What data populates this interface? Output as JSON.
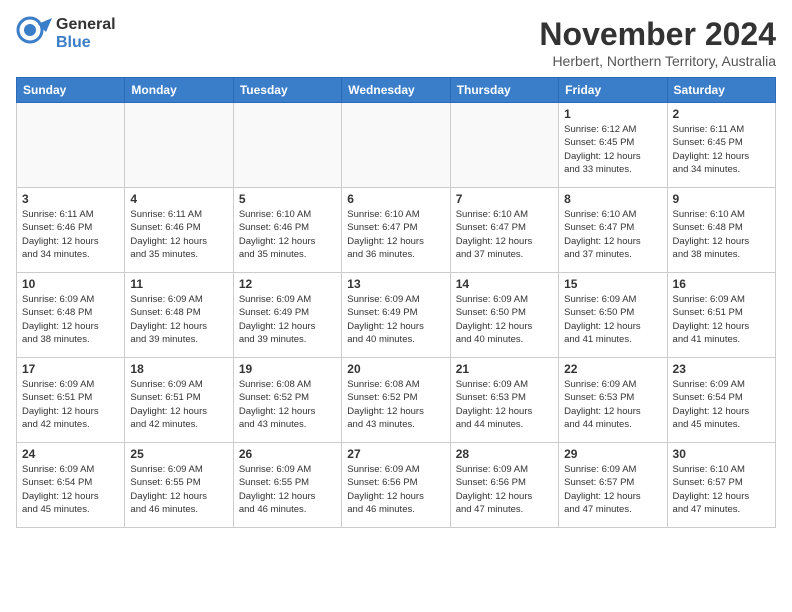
{
  "header": {
    "logo_general": "General",
    "logo_blue": "Blue",
    "month": "November 2024",
    "location": "Herbert, Northern Territory, Australia"
  },
  "weekdays": [
    "Sunday",
    "Monday",
    "Tuesday",
    "Wednesday",
    "Thursday",
    "Friday",
    "Saturday"
  ],
  "weeks": [
    [
      {
        "day": "",
        "info": ""
      },
      {
        "day": "",
        "info": ""
      },
      {
        "day": "",
        "info": ""
      },
      {
        "day": "",
        "info": ""
      },
      {
        "day": "",
        "info": ""
      },
      {
        "day": "1",
        "info": "Sunrise: 6:12 AM\nSunset: 6:45 PM\nDaylight: 12 hours\nand 33 minutes."
      },
      {
        "day": "2",
        "info": "Sunrise: 6:11 AM\nSunset: 6:45 PM\nDaylight: 12 hours\nand 34 minutes."
      }
    ],
    [
      {
        "day": "3",
        "info": "Sunrise: 6:11 AM\nSunset: 6:46 PM\nDaylight: 12 hours\nand 34 minutes."
      },
      {
        "day": "4",
        "info": "Sunrise: 6:11 AM\nSunset: 6:46 PM\nDaylight: 12 hours\nand 35 minutes."
      },
      {
        "day": "5",
        "info": "Sunrise: 6:10 AM\nSunset: 6:46 PM\nDaylight: 12 hours\nand 35 minutes."
      },
      {
        "day": "6",
        "info": "Sunrise: 6:10 AM\nSunset: 6:47 PM\nDaylight: 12 hours\nand 36 minutes."
      },
      {
        "day": "7",
        "info": "Sunrise: 6:10 AM\nSunset: 6:47 PM\nDaylight: 12 hours\nand 37 minutes."
      },
      {
        "day": "8",
        "info": "Sunrise: 6:10 AM\nSunset: 6:47 PM\nDaylight: 12 hours\nand 37 minutes."
      },
      {
        "day": "9",
        "info": "Sunrise: 6:10 AM\nSunset: 6:48 PM\nDaylight: 12 hours\nand 38 minutes."
      }
    ],
    [
      {
        "day": "10",
        "info": "Sunrise: 6:09 AM\nSunset: 6:48 PM\nDaylight: 12 hours\nand 38 minutes."
      },
      {
        "day": "11",
        "info": "Sunrise: 6:09 AM\nSunset: 6:48 PM\nDaylight: 12 hours\nand 39 minutes."
      },
      {
        "day": "12",
        "info": "Sunrise: 6:09 AM\nSunset: 6:49 PM\nDaylight: 12 hours\nand 39 minutes."
      },
      {
        "day": "13",
        "info": "Sunrise: 6:09 AM\nSunset: 6:49 PM\nDaylight: 12 hours\nand 40 minutes."
      },
      {
        "day": "14",
        "info": "Sunrise: 6:09 AM\nSunset: 6:50 PM\nDaylight: 12 hours\nand 40 minutes."
      },
      {
        "day": "15",
        "info": "Sunrise: 6:09 AM\nSunset: 6:50 PM\nDaylight: 12 hours\nand 41 minutes."
      },
      {
        "day": "16",
        "info": "Sunrise: 6:09 AM\nSunset: 6:51 PM\nDaylight: 12 hours\nand 41 minutes."
      }
    ],
    [
      {
        "day": "17",
        "info": "Sunrise: 6:09 AM\nSunset: 6:51 PM\nDaylight: 12 hours\nand 42 minutes."
      },
      {
        "day": "18",
        "info": "Sunrise: 6:09 AM\nSunset: 6:51 PM\nDaylight: 12 hours\nand 42 minutes."
      },
      {
        "day": "19",
        "info": "Sunrise: 6:08 AM\nSunset: 6:52 PM\nDaylight: 12 hours\nand 43 minutes."
      },
      {
        "day": "20",
        "info": "Sunrise: 6:08 AM\nSunset: 6:52 PM\nDaylight: 12 hours\nand 43 minutes."
      },
      {
        "day": "21",
        "info": "Sunrise: 6:09 AM\nSunset: 6:53 PM\nDaylight: 12 hours\nand 44 minutes."
      },
      {
        "day": "22",
        "info": "Sunrise: 6:09 AM\nSunset: 6:53 PM\nDaylight: 12 hours\nand 44 minutes."
      },
      {
        "day": "23",
        "info": "Sunrise: 6:09 AM\nSunset: 6:54 PM\nDaylight: 12 hours\nand 45 minutes."
      }
    ],
    [
      {
        "day": "24",
        "info": "Sunrise: 6:09 AM\nSunset: 6:54 PM\nDaylight: 12 hours\nand 45 minutes."
      },
      {
        "day": "25",
        "info": "Sunrise: 6:09 AM\nSunset: 6:55 PM\nDaylight: 12 hours\nand 46 minutes."
      },
      {
        "day": "26",
        "info": "Sunrise: 6:09 AM\nSunset: 6:55 PM\nDaylight: 12 hours\nand 46 minutes."
      },
      {
        "day": "27",
        "info": "Sunrise: 6:09 AM\nSunset: 6:56 PM\nDaylight: 12 hours\nand 46 minutes."
      },
      {
        "day": "28",
        "info": "Sunrise: 6:09 AM\nSunset: 6:56 PM\nDaylight: 12 hours\nand 47 minutes."
      },
      {
        "day": "29",
        "info": "Sunrise: 6:09 AM\nSunset: 6:57 PM\nDaylight: 12 hours\nand 47 minutes."
      },
      {
        "day": "30",
        "info": "Sunrise: 6:10 AM\nSunset: 6:57 PM\nDaylight: 12 hours\nand 47 minutes."
      }
    ]
  ]
}
